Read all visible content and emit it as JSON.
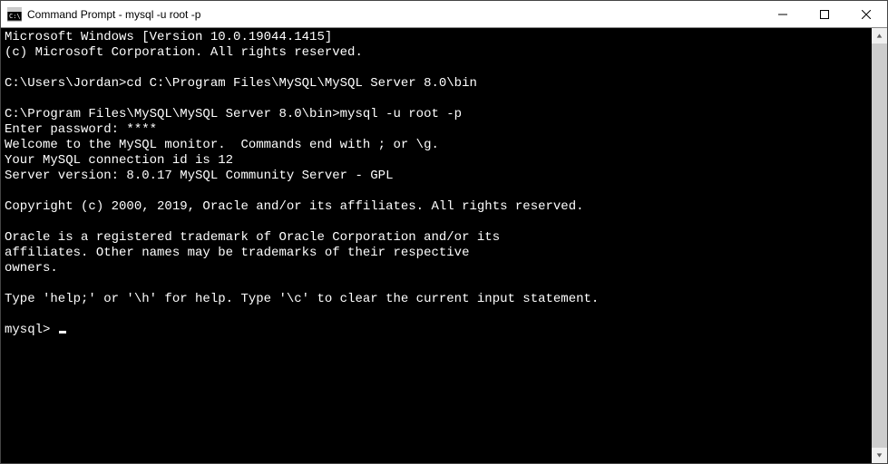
{
  "title": "Command Prompt - mysql  -u root -p",
  "terminal": {
    "lines": [
      "Microsoft Windows [Version 10.0.19044.1415]",
      "(c) Microsoft Corporation. All rights reserved.",
      "",
      "C:\\Users\\Jordan>cd C:\\Program Files\\MySQL\\MySQL Server 8.0\\bin",
      "",
      "C:\\Program Files\\MySQL\\MySQL Server 8.0\\bin>mysql -u root -p",
      "Enter password: ****",
      "Welcome to the MySQL monitor.  Commands end with ; or \\g.",
      "Your MySQL connection id is 12",
      "Server version: 8.0.17 MySQL Community Server - GPL",
      "",
      "Copyright (c) 2000, 2019, Oracle and/or its affiliates. All rights reserved.",
      "",
      "Oracle is a registered trademark of Oracle Corporation and/or its",
      "affiliates. Other names may be trademarks of their respective",
      "owners.",
      "",
      "Type 'help;' or '\\h' for help. Type '\\c' to clear the current input statement.",
      ""
    ],
    "prompt": "mysql> "
  }
}
